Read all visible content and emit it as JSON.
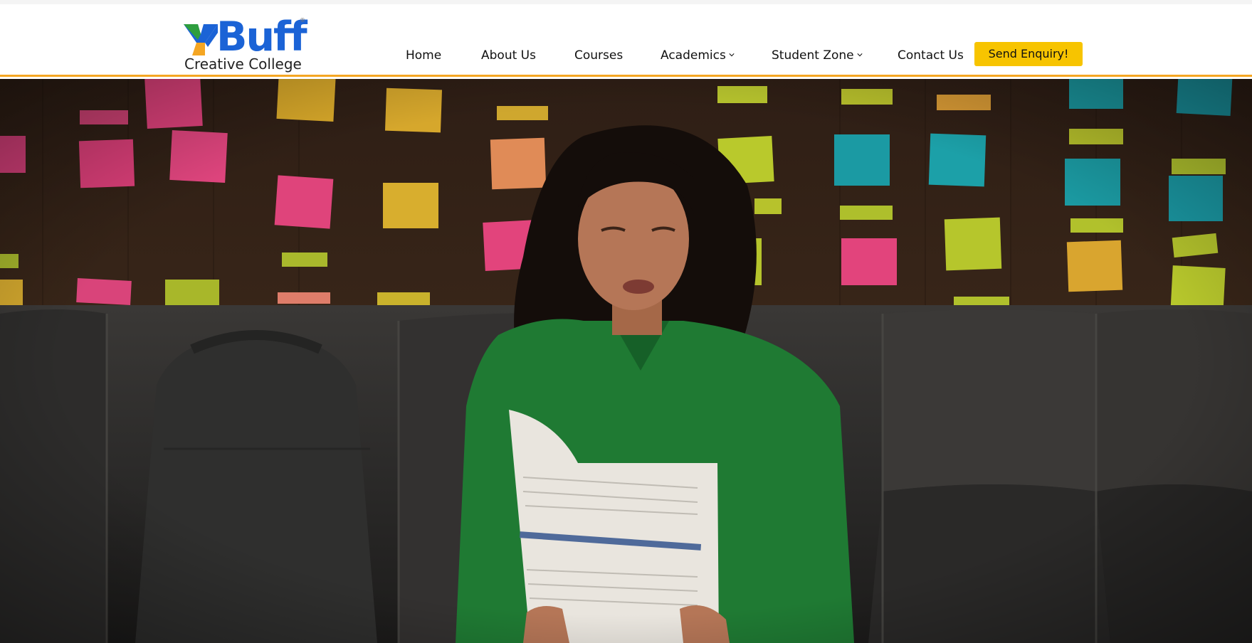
{
  "brand": {
    "wordmark": "Buff",
    "tagline": "Creative College",
    "registered_mark": "®",
    "colors": {
      "blue": "#1b63d6",
      "green": "#2e9e3e",
      "orange": "#f5a623"
    }
  },
  "nav": {
    "items": [
      {
        "label": "Home",
        "has_dropdown": false
      },
      {
        "label": "About Us",
        "has_dropdown": false
      },
      {
        "label": "Courses",
        "has_dropdown": false
      },
      {
        "label": "Academics",
        "has_dropdown": true,
        "icon": "chevron-down-icon"
      },
      {
        "label": "Student Zone",
        "has_dropdown": true,
        "icon": "chevron-down-icon"
      },
      {
        "label": "Contact Us",
        "has_dropdown": false
      }
    ],
    "cta_label": "Send Enquiry!",
    "cta_color": "#f7c400",
    "header_border_color": "#f5a623"
  },
  "hero": {
    "image_description_icon": "hero-photo"
  }
}
